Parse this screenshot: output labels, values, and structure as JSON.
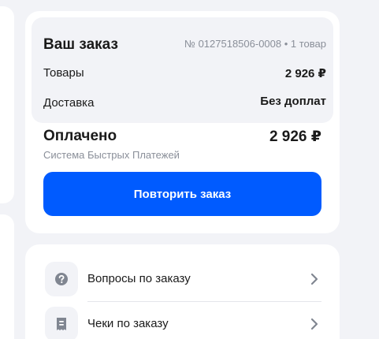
{
  "order": {
    "title": "Ваш заказ",
    "meta": "№ 0127518506-0008 • 1 товар",
    "goods_label": "Товары",
    "goods_value": "2 926 ₽",
    "delivery_label": "Доставка",
    "delivery_value": "Без доплат"
  },
  "payment": {
    "status": "Оплачено",
    "amount": "2 926 ₽",
    "method": "Система Быстрых Платежей",
    "repeat_button": "Повторить заказ"
  },
  "links": [
    {
      "label": "Вопросы по заказу",
      "icon": "question-icon"
    },
    {
      "label": "Чеки по заказу",
      "icon": "receipt-icon"
    }
  ],
  "colors": {
    "accent": "#005bff",
    "background": "#f2f3f7",
    "muted_text": "#8a8f99"
  }
}
